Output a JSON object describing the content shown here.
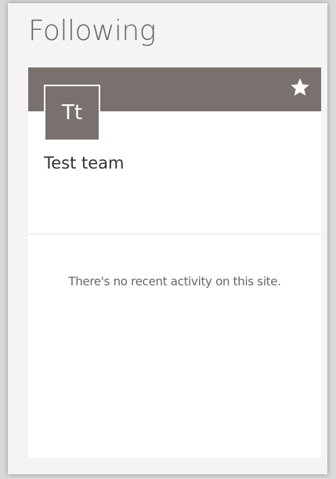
{
  "heading": "Following",
  "card": {
    "initials": "Tt",
    "name": "Test team",
    "empty_activity": "There's no recent activity on this site.",
    "follow_icon": "star-icon",
    "banner_color": "#7a716f"
  }
}
